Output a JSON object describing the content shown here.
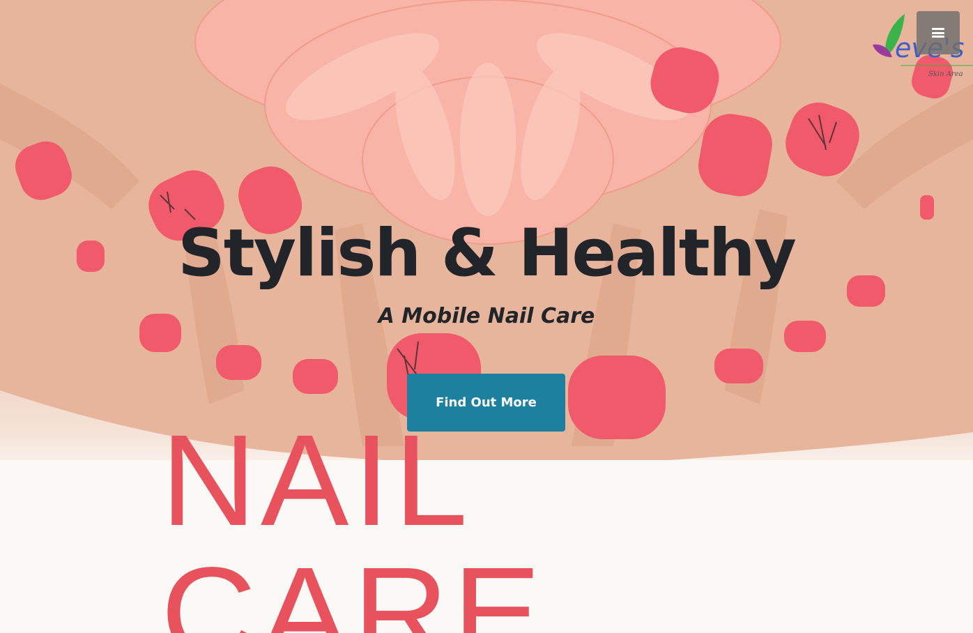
{
  "brand": {
    "logo_text": "eve's",
    "logo_tagline": "Skin Area",
    "colors": {
      "leaf_green": "#3cb34a",
      "leaf_purple": "#9b3a9e",
      "logo_blue": "#3f5fc8"
    }
  },
  "header": {
    "menu_icon": "hamburger-menu-icon"
  },
  "hero": {
    "headline": "Stylish & Healthy",
    "subheadline": "A Mobile Nail Care",
    "cta_label": "Find Out More",
    "banner_text": "NAIL CARE",
    "colors": {
      "cta_bg": "#1d809f",
      "banner_text": "#e8525d",
      "nail_polish": "#f05a6a",
      "flower": "#f8b4a6"
    }
  }
}
